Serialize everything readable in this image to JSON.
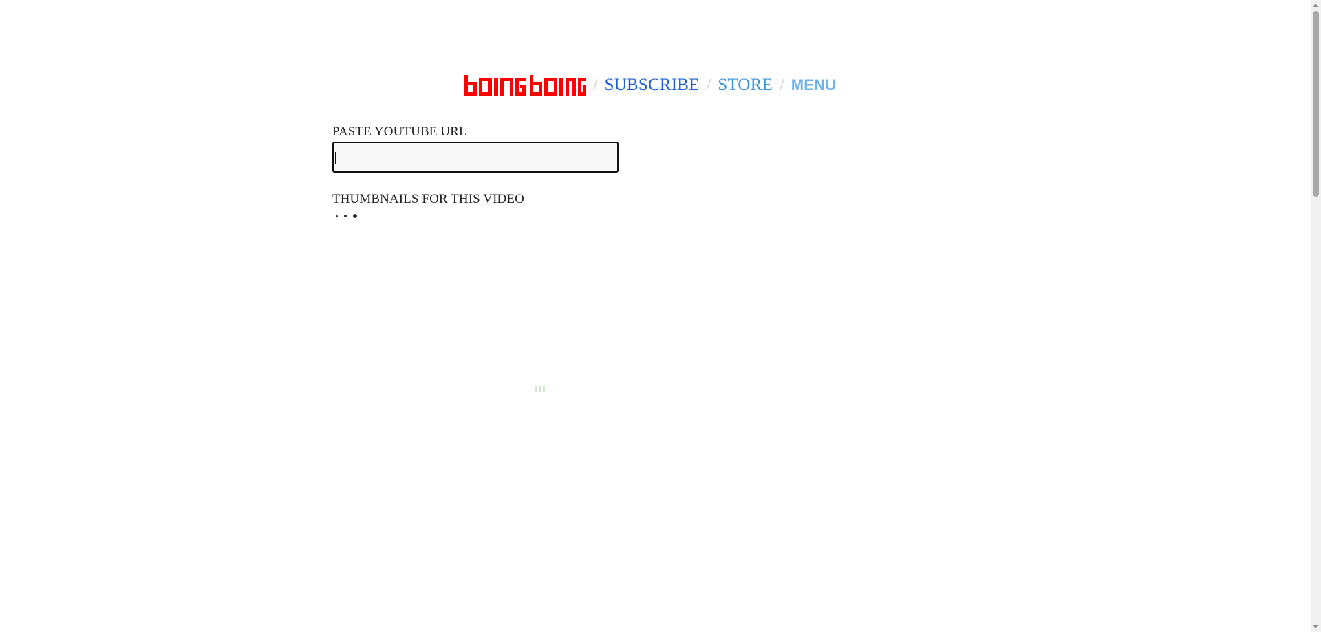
{
  "header": {
    "logo_text": "bOING bOING",
    "logo_color": "#ff0000",
    "separator": "/",
    "nav_items": [
      {
        "label": "SUBSCRIBE",
        "color": "#1a5fd6"
      },
      {
        "label": "STORE",
        "color": "#3a94e0"
      },
      {
        "label": "MENU",
        "color": "#6cb2ee"
      }
    ]
  },
  "form": {
    "url_label": "PASTE YOUTUBE URL",
    "url_value": "",
    "url_placeholder": "",
    "thumbnails_label": "THUMBNAILS FOR THIS VIDEO",
    "thumbnails_state_icon": "loading-dots-icon"
  },
  "loader_icon": "loading-bars-icon"
}
